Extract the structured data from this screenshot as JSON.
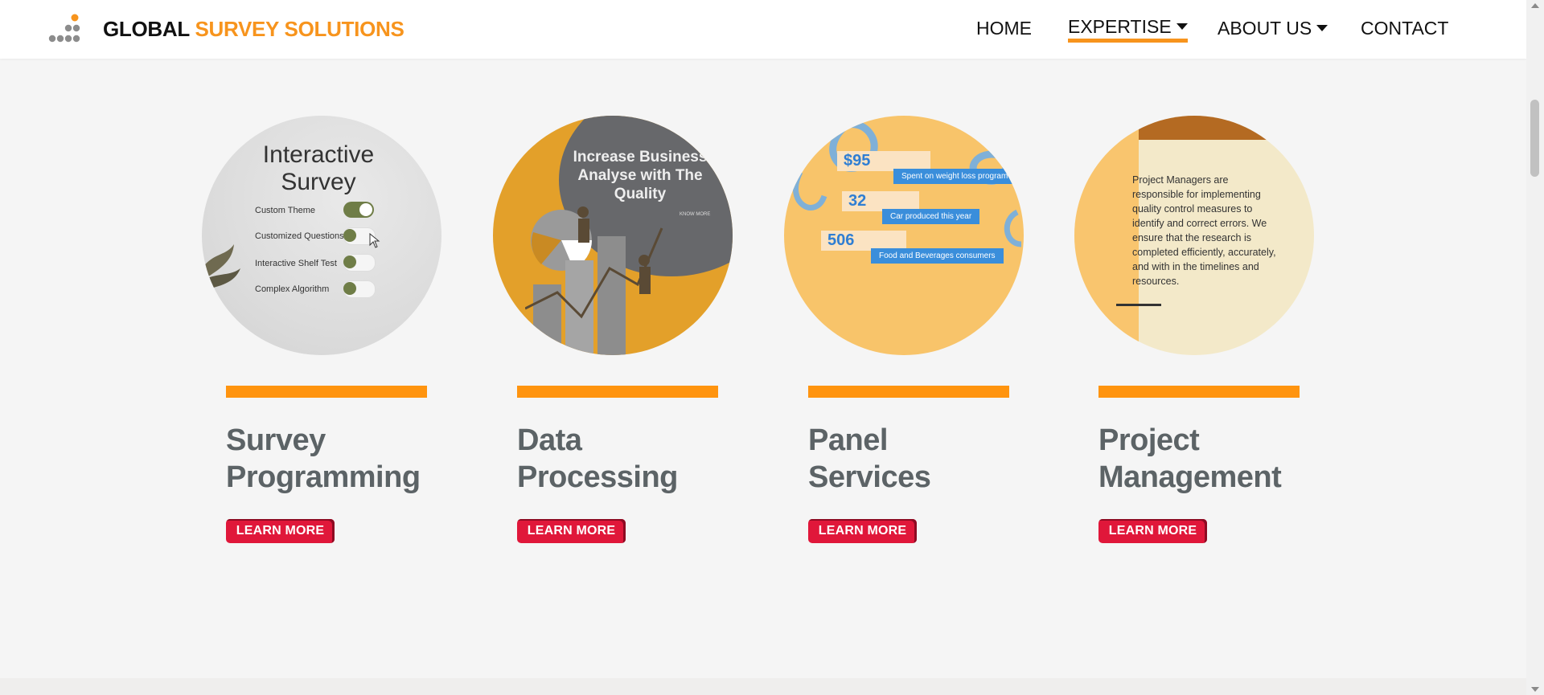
{
  "header": {
    "logo_primary": "GLOBAL",
    "logo_secondary": "SURVEY SOLUTIONS",
    "nav": [
      {
        "label": "HOME",
        "dropdown": false,
        "active": false
      },
      {
        "label": "EXPERTISE",
        "dropdown": true,
        "active": true
      },
      {
        "label": "ABOUT US",
        "dropdown": true,
        "active": false
      },
      {
        "label": "CONTACT",
        "dropdown": false,
        "active": false
      }
    ]
  },
  "colors": {
    "accent_orange": "#f7941d",
    "button_red": "#e0173a",
    "title_gray": "#5c6366"
  },
  "services": [
    {
      "title_line1": "Survey",
      "title_line2": "Programming",
      "button": "LEARN MORE",
      "image": {
        "heading_line1": "Interactive",
        "heading_line2": "Survey",
        "options": [
          {
            "label": "Custom Theme",
            "on": true
          },
          {
            "label": "Customized Questions",
            "on": false
          },
          {
            "label": "Interactive Shelf Test",
            "on": false
          },
          {
            "label": "Complex Algorithm",
            "on": false
          }
        ]
      }
    },
    {
      "title_line1": "Data",
      "title_line2": "Processing",
      "button": "LEARN MORE",
      "image": {
        "heading": "Increase Business Analyse with The Quality",
        "small": "KNOW MORE"
      }
    },
    {
      "title_line1": "Panel",
      "title_line2": "Services",
      "button": "LEARN MORE",
      "image": {
        "stats": [
          {
            "value": "$95",
            "label": "Spent on weight loss program"
          },
          {
            "value": "32",
            "label": "Car produced this year"
          },
          {
            "value": "506",
            "label": "Food and Beverages consumers"
          }
        ]
      }
    },
    {
      "title_line1": "Project",
      "title_line2": "Management",
      "button": "LEARN MORE",
      "image": {
        "text": "Project Managers are responsible for implementing quality control measures to identify and correct errors. We ensure that the research is completed efficiently, accurately, and with in the timelines and resources."
      }
    }
  ]
}
